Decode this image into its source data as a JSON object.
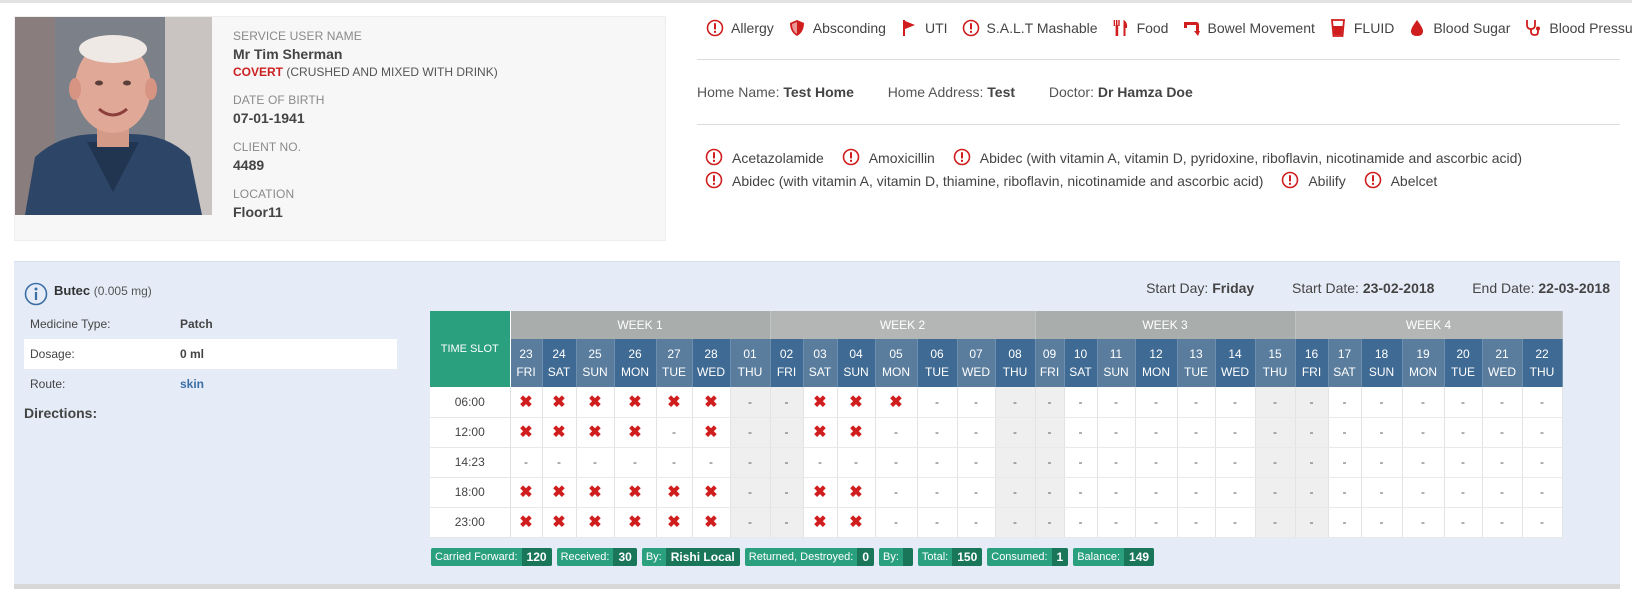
{
  "profile": {
    "service_user_label": "SERVICE USER NAME",
    "service_user_name": "Mr Tim Sherman",
    "covert_flag": "COVERT",
    "covert_note": "(CRUSHED AND MIXED WITH DRINK)",
    "dob_label": "DATE OF BIRTH",
    "dob": "07-01-1941",
    "client_no_label": "CLIENT NO.",
    "client_no": "4489",
    "location_label": "LOCATION",
    "location": "Floor11"
  },
  "alerts": [
    {
      "label": "Allergy",
      "icon": "exclamation-circle-icon"
    },
    {
      "label": "Absconding",
      "icon": "shield-icon"
    },
    {
      "label": "UTI",
      "icon": "flag-icon"
    },
    {
      "label": "S.A.L.T Mashable",
      "icon": "exclamation-circle-icon"
    },
    {
      "label": "Food",
      "icon": "cutlery-icon"
    },
    {
      "label": "Bowel Movement",
      "icon": "pipe-icon"
    },
    {
      "label": "FLUID",
      "icon": "glass-icon"
    },
    {
      "label": "Blood Sugar",
      "icon": "drop-icon"
    },
    {
      "label": "Blood Pressure",
      "icon": "stethoscope-icon"
    }
  ],
  "home": {
    "home_name_label": "Home Name:",
    "home_name": "Test Home",
    "home_address_label": "Home Address:",
    "home_address": "Test",
    "doctor_label": "Doctor:",
    "doctor": "Dr Hamza Doe"
  },
  "allergies": [
    "Acetazolamide",
    "Amoxicillin",
    "Abidec (with vitamin A, vitamin D, pyridoxine, riboflavin, nicotinamide and ascorbic acid)",
    "Abidec (with vitamin A, vitamin D, thiamine, riboflavin, nicotinamide and ascorbic acid)",
    "Abilify",
    "Abelcet"
  ],
  "medicine": {
    "name": "Butec",
    "dose": "(0.005 mg)",
    "start_day_label": "Start Day:",
    "start_day": "Friday",
    "start_date_label": "Start Date:",
    "start_date": "23-02-2018",
    "end_date_label": "End Date:",
    "end_date": "22-03-2018",
    "type_label": "Medicine Type:",
    "type": "Patch",
    "dosage_label": "Dosage:",
    "dosage": "0 ml",
    "route_label": "Route:",
    "route": "skin",
    "directions_label": "Directions:"
  },
  "schedule": {
    "time_slot_label": "TIME SLOT",
    "weeks": [
      "WEEK 1",
      "WEEK 2",
      "WEEK 3",
      "WEEK 4"
    ],
    "days": [
      {
        "d": "23",
        "w": "FRI"
      },
      {
        "d": "24",
        "w": "SAT"
      },
      {
        "d": "25",
        "w": "SUN"
      },
      {
        "d": "26",
        "w": "MON"
      },
      {
        "d": "27",
        "w": "TUE"
      },
      {
        "d": "28",
        "w": "WED"
      },
      {
        "d": "01",
        "w": "THU"
      },
      {
        "d": "02",
        "w": "FRI"
      },
      {
        "d": "03",
        "w": "SAT"
      },
      {
        "d": "04",
        "w": "SUN"
      },
      {
        "d": "05",
        "w": "MON"
      },
      {
        "d": "06",
        "w": "TUE"
      },
      {
        "d": "07",
        "w": "WED"
      },
      {
        "d": "08",
        "w": "THU"
      },
      {
        "d": "09",
        "w": "FRI"
      },
      {
        "d": "10",
        "w": "SAT"
      },
      {
        "d": "11",
        "w": "SUN"
      },
      {
        "d": "12",
        "w": "MON"
      },
      {
        "d": "13",
        "w": "TUE"
      },
      {
        "d": "14",
        "w": "WED"
      },
      {
        "d": "15",
        "w": "THU"
      },
      {
        "d": "16",
        "w": "FRI"
      },
      {
        "d": "17",
        "w": "SAT"
      },
      {
        "d": "18",
        "w": "SUN"
      },
      {
        "d": "19",
        "w": "MON"
      },
      {
        "d": "20",
        "w": "TUE"
      },
      {
        "d": "21",
        "w": "WED"
      },
      {
        "d": "22",
        "w": "THU"
      }
    ],
    "slots": [
      {
        "time": "06:00",
        "cells": [
          "x",
          "x",
          "x",
          "x",
          "x",
          "x",
          "-",
          "-",
          "x",
          "x",
          "x",
          "-",
          "-",
          "-",
          "-",
          "-",
          "-",
          "-",
          "-",
          "-",
          "-",
          "-",
          "-",
          "-",
          "-",
          "-",
          "-",
          "-"
        ]
      },
      {
        "time": "12:00",
        "cells": [
          "x",
          "x",
          "x",
          "x",
          "-",
          "x",
          "-",
          "-",
          "x",
          "x",
          "-",
          "-",
          "-",
          "-",
          "-",
          "-",
          "-",
          "-",
          "-",
          "-",
          "-",
          "-",
          "-",
          "-",
          "-",
          "-",
          "-",
          "-"
        ]
      },
      {
        "time": "14:23",
        "cells": [
          "-",
          "-",
          "-",
          "-",
          "-",
          "-",
          "-",
          "-",
          "-",
          "-",
          "-",
          "-",
          "-",
          "-",
          "-",
          "-",
          "-",
          "-",
          "-",
          "-",
          "-",
          "-",
          "-",
          "-",
          "-",
          "-",
          "-",
          "-"
        ]
      },
      {
        "time": "18:00",
        "cells": [
          "x",
          "x",
          "x",
          "x",
          "x",
          "x",
          "-",
          "-",
          "x",
          "x",
          "-",
          "-",
          "-",
          "-",
          "-",
          "-",
          "-",
          "-",
          "-",
          "-",
          "-",
          "-",
          "-",
          "-",
          "-",
          "-",
          "-",
          "-"
        ]
      },
      {
        "time": "23:00",
        "cells": [
          "x",
          "x",
          "x",
          "x",
          "x",
          "x",
          "-",
          "-",
          "x",
          "x",
          "-",
          "-",
          "-",
          "-",
          "-",
          "-",
          "-",
          "-",
          "-",
          "-",
          "-",
          "-",
          "-",
          "-",
          "-",
          "-",
          "-",
          "-"
        ]
      }
    ],
    "dash": "-"
  },
  "stock": [
    {
      "label": "Carried Forward:",
      "value": "120"
    },
    {
      "label": "Received:",
      "value": "30"
    },
    {
      "label": "By:",
      "value": "Rishi Local"
    },
    {
      "label": "Returned, Destroyed:",
      "value": "0"
    },
    {
      "label": "By:",
      "value": ""
    },
    {
      "label": "Total:",
      "value": "150"
    },
    {
      "label": "Consumed:",
      "value": "1"
    },
    {
      "label": "Balance:",
      "value": "149"
    }
  ],
  "colors": {
    "alert_red": "#d01d1d",
    "teal": "#2aa07e",
    "day_header_blue": "#5a7d9e"
  }
}
